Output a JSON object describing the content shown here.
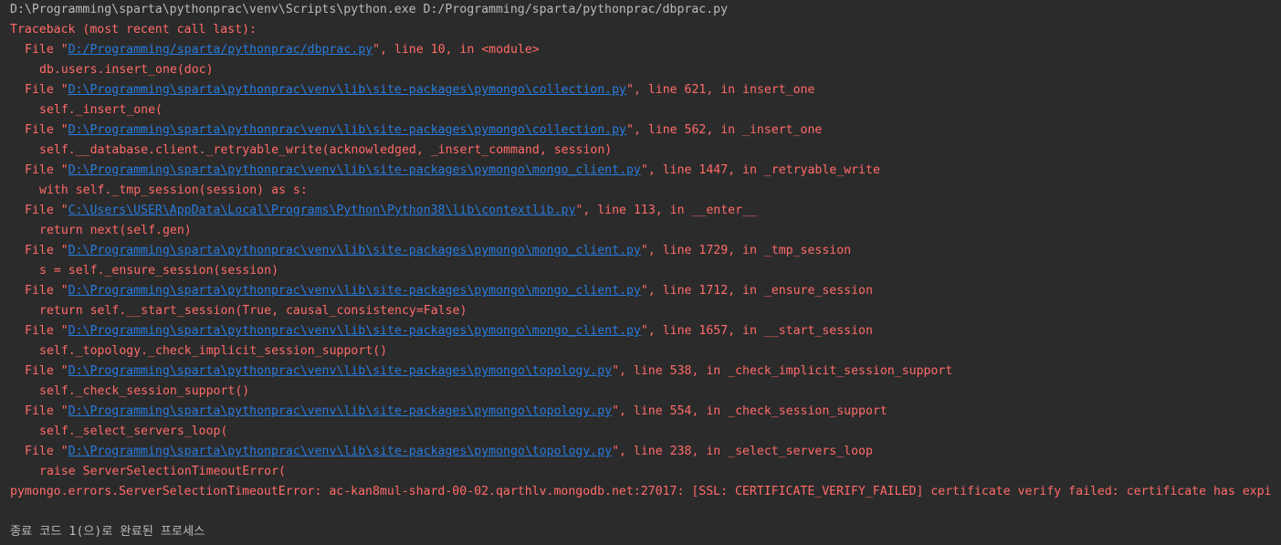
{
  "console": {
    "command": "D:\\Programming\\sparta\\pythonprac\\venv\\Scripts\\python.exe D:/Programming/sparta/pythonprac/dbprac.py",
    "traceback_header": "Traceback (most recent call last):",
    "frames": [
      {
        "path": "D:/Programming/sparta/pythonprac/dbprac.py",
        "suffix": "\", line 10, in <module>",
        "code": "db.users.insert_one(doc)"
      },
      {
        "path": "D:\\Programming\\sparta\\pythonprac\\venv\\lib\\site-packages\\pymongo\\collection.py",
        "suffix": "\", line 621, in insert_one",
        "code": "self._insert_one("
      },
      {
        "path": "D:\\Programming\\sparta\\pythonprac\\venv\\lib\\site-packages\\pymongo\\collection.py",
        "suffix": "\", line 562, in _insert_one",
        "code": "self.__database.client._retryable_write(acknowledged, _insert_command, session)"
      },
      {
        "path": "D:\\Programming\\sparta\\pythonprac\\venv\\lib\\site-packages\\pymongo\\mongo_client.py",
        "suffix": "\", line 1447, in _retryable_write",
        "code": "with self._tmp_session(session) as s:"
      },
      {
        "path": "C:\\Users\\USER\\AppData\\Local\\Programs\\Python\\Python38\\lib\\contextlib.py",
        "suffix": "\", line 113, in __enter__",
        "code": "return next(self.gen)"
      },
      {
        "path": "D:\\Programming\\sparta\\pythonprac\\venv\\lib\\site-packages\\pymongo\\mongo_client.py",
        "suffix": "\", line 1729, in _tmp_session",
        "code": "s = self._ensure_session(session)"
      },
      {
        "path": "D:\\Programming\\sparta\\pythonprac\\venv\\lib\\site-packages\\pymongo\\mongo_client.py",
        "suffix": "\", line 1712, in _ensure_session",
        "code": "return self.__start_session(True, causal_consistency=False)"
      },
      {
        "path": "D:\\Programming\\sparta\\pythonprac\\venv\\lib\\site-packages\\pymongo\\mongo_client.py",
        "suffix": "\", line 1657, in __start_session",
        "code": "self._topology._check_implicit_session_support()"
      },
      {
        "path": "D:\\Programming\\sparta\\pythonprac\\venv\\lib\\site-packages\\pymongo\\topology.py",
        "suffix": "\", line 538, in _check_implicit_session_support",
        "code": "self._check_session_support()"
      },
      {
        "path": "D:\\Programming\\sparta\\pythonprac\\venv\\lib\\site-packages\\pymongo\\topology.py",
        "suffix": "\", line 554, in _check_session_support",
        "code": "self._select_servers_loop("
      },
      {
        "path": "D:\\Programming\\sparta\\pythonprac\\venv\\lib\\site-packages\\pymongo\\topology.py",
        "suffix": "\", line 238, in _select_servers_loop",
        "code": "raise ServerSelectionTimeoutError("
      }
    ],
    "frame_prefix": "File \"",
    "error_message": "pymongo.errors.ServerSelectionTimeoutError: ac-kan8mul-shard-00-02.qarthlv.mongodb.net:27017: [SSL: CERTIFICATE_VERIFY_FAILED] certificate verify failed: certificate has expi",
    "exit_message": "종료 코드 1(으)로 완료된 프로세스"
  },
  "colors": {
    "background": "#2b2b2b",
    "default_text": "#bbbbbb",
    "error_text": "#ff6b68",
    "link": "#287bde"
  }
}
